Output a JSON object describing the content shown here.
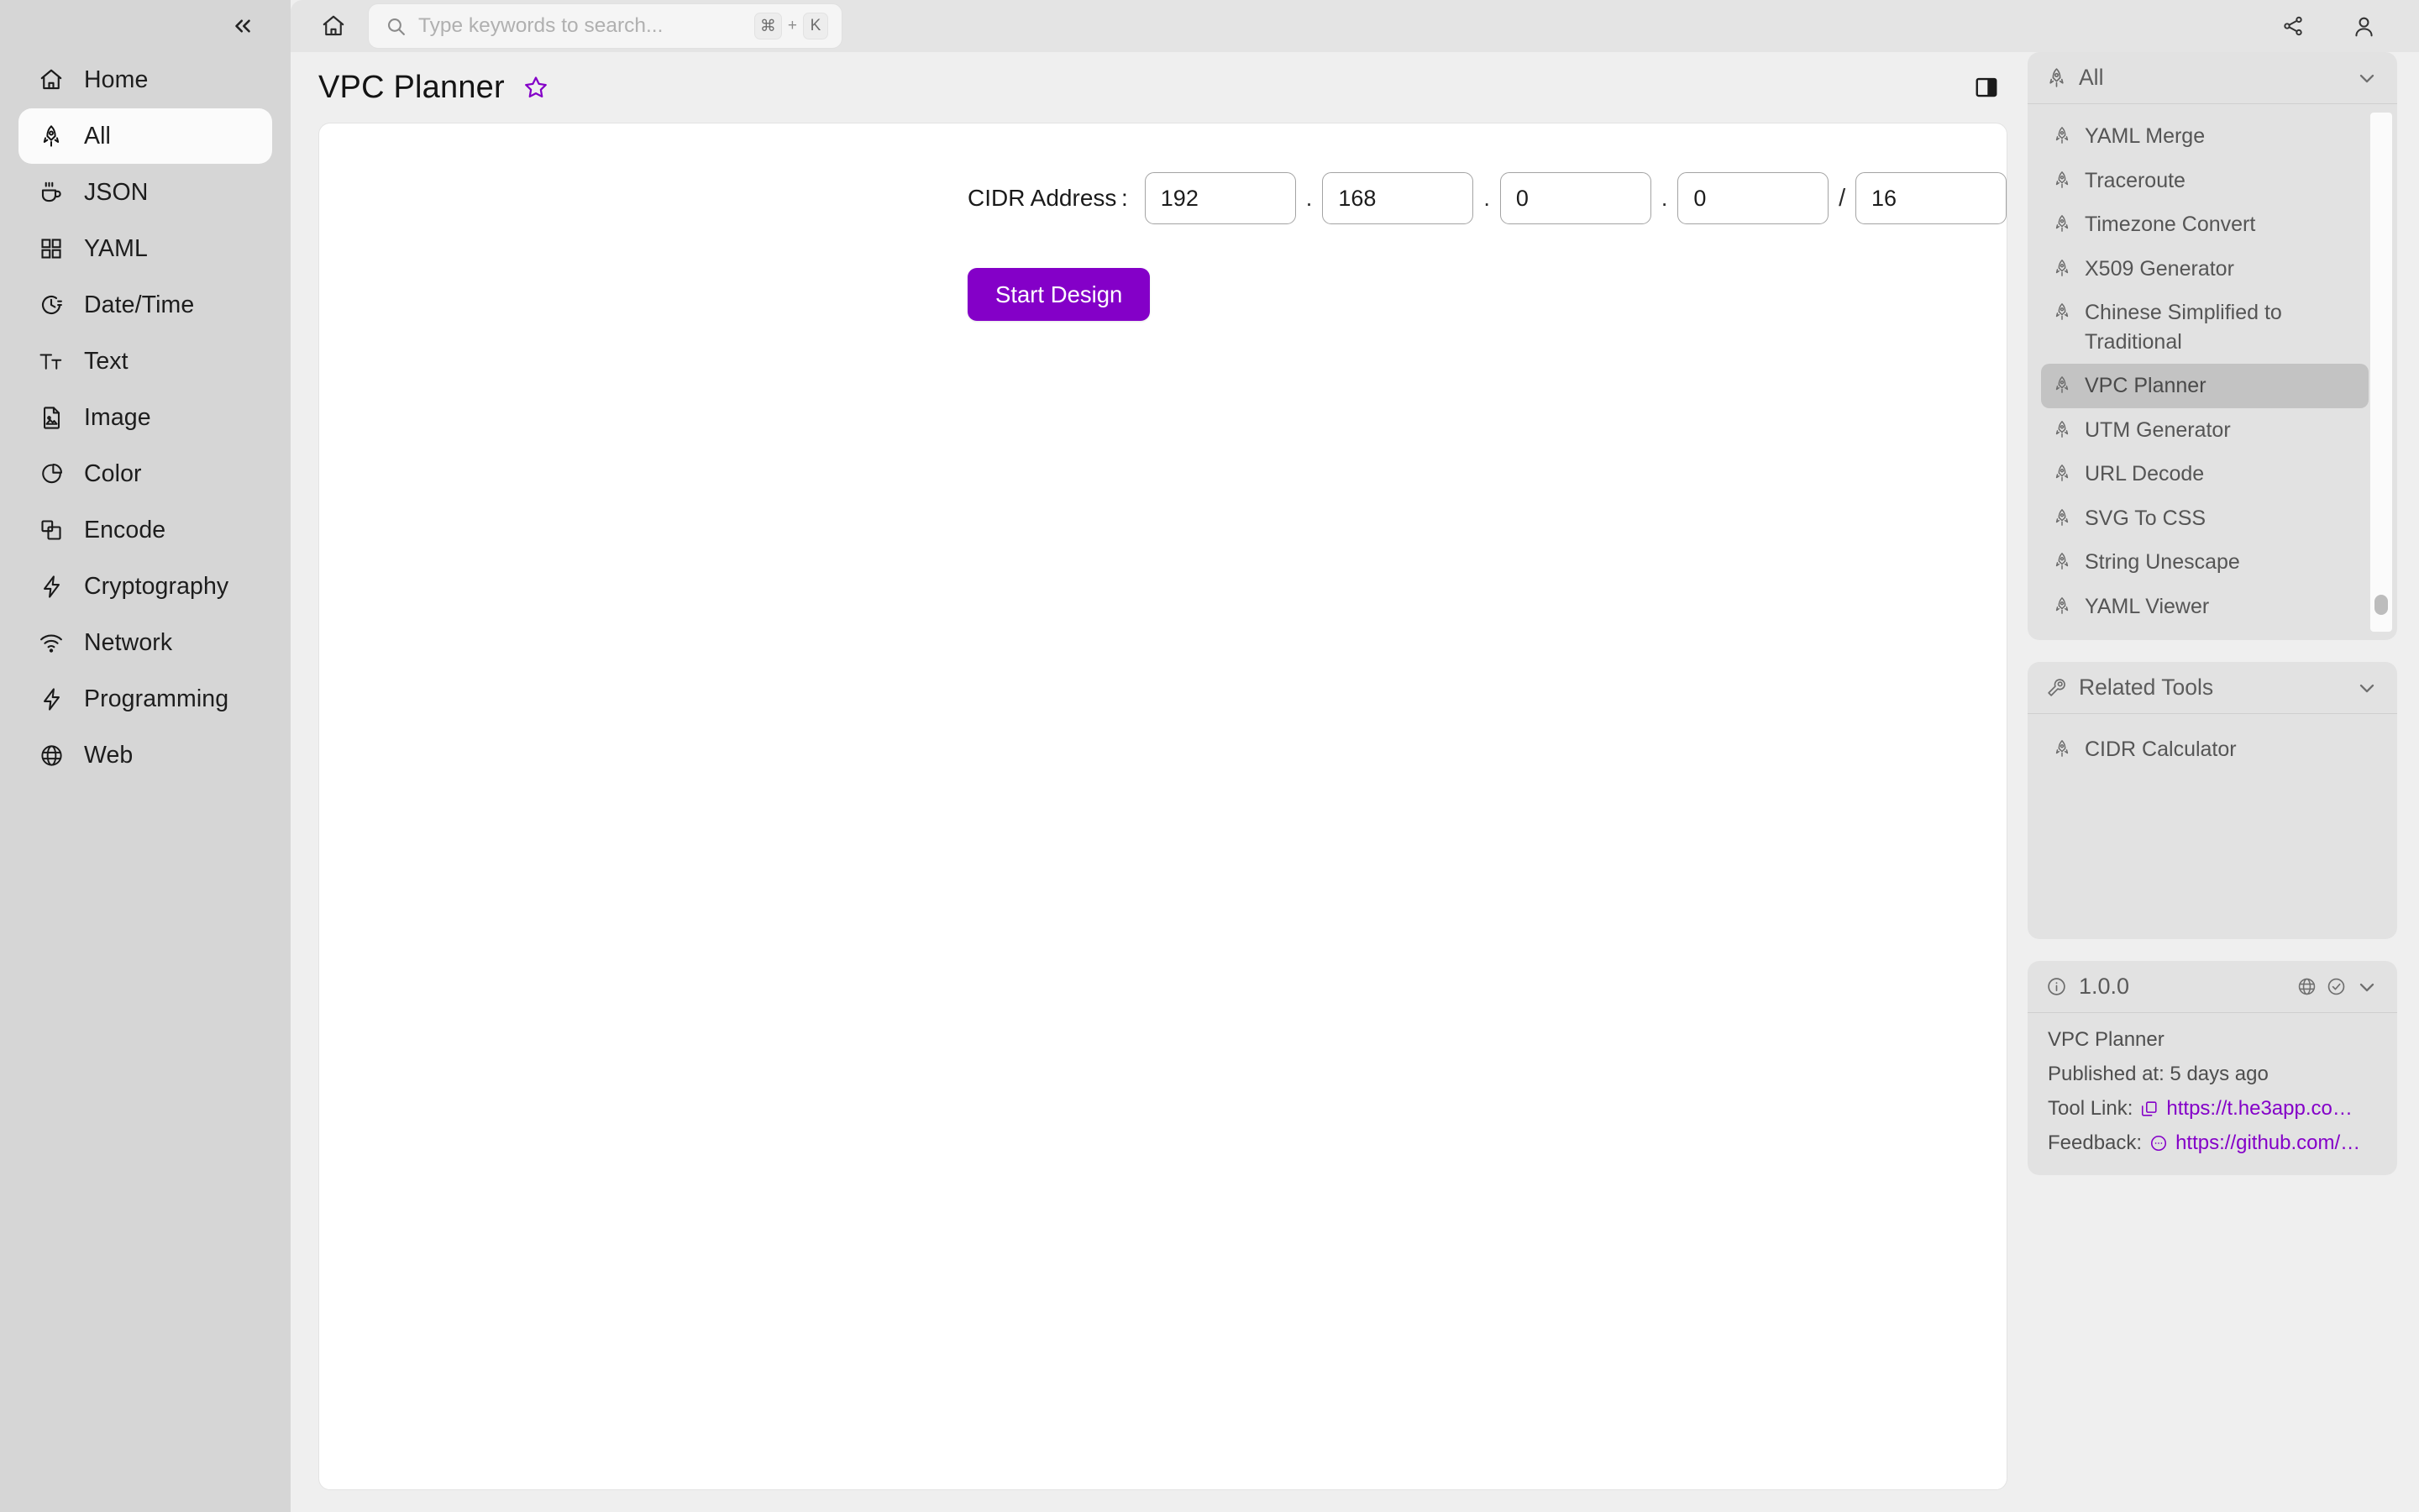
{
  "sidebar": {
    "collapse_icon": "chevrons-left-icon",
    "items": [
      {
        "label": "Home",
        "icon": "home-icon",
        "active": false
      },
      {
        "label": "All",
        "icon": "rocket-icon",
        "active": true
      },
      {
        "label": "JSON",
        "icon": "coffee-icon",
        "active": false
      },
      {
        "label": "YAML",
        "icon": "grid-icon",
        "active": false
      },
      {
        "label": "Date/Time",
        "icon": "clock-icon",
        "active": false
      },
      {
        "label": "Text",
        "icon": "text-size-icon",
        "active": false
      },
      {
        "label": "Image",
        "icon": "image-file-icon",
        "active": false
      },
      {
        "label": "Color",
        "icon": "pie-chart-icon",
        "active": false
      },
      {
        "label": "Encode",
        "icon": "layers-icon",
        "active": false
      },
      {
        "label": "Cryptography",
        "icon": "bolt-icon",
        "active": false
      },
      {
        "label": "Network",
        "icon": "wifi-icon",
        "active": false
      },
      {
        "label": "Programming",
        "icon": "bolt-icon",
        "active": false
      },
      {
        "label": "Web",
        "icon": "globe-icon",
        "active": false
      }
    ]
  },
  "topbar": {
    "home_icon": "home-icon",
    "search": {
      "placeholder": "Type keywords to search...",
      "value": "",
      "icon": "search-icon",
      "shortcut_key1": "⌘",
      "shortcut_plus": "+",
      "shortcut_key2": "K"
    },
    "share_icon": "share-icon",
    "account_icon": "user-icon"
  },
  "page": {
    "title": "VPC Planner",
    "favorite_icon": "star-outline-icon",
    "favorite_color": "#8400c8",
    "panel_toggle_icon": "panel-right-icon"
  },
  "form": {
    "cidr_label": "CIDR Address :",
    "octets": [
      "192",
      "168",
      "0",
      "0"
    ],
    "prefix": "16",
    "dot": ".",
    "slash": "/",
    "submit_label": "Start Design",
    "submit_color": "#8400c8"
  },
  "rail": {
    "tools_panel": {
      "title": "All",
      "icon": "rocket-icon",
      "chevron": "chevron-down-icon",
      "items": [
        {
          "label": "YAML Merge",
          "selected": false
        },
        {
          "label": "Traceroute",
          "selected": false
        },
        {
          "label": "Timezone Convert",
          "selected": false
        },
        {
          "label": "X509 Generator",
          "selected": false
        },
        {
          "label": "Chinese Simplified to Traditional",
          "selected": false
        },
        {
          "label": "VPC Planner",
          "selected": true
        },
        {
          "label": "UTM Generator",
          "selected": false
        },
        {
          "label": "URL Decode",
          "selected": false
        },
        {
          "label": "SVG To CSS",
          "selected": false
        },
        {
          "label": "String Unescape",
          "selected": false
        },
        {
          "label": "YAML Viewer",
          "selected": false
        }
      ]
    },
    "related_panel": {
      "title": "Related Tools",
      "icon": "wrench-icon",
      "chevron": "chevron-down-icon",
      "items": [
        {
          "label": "CIDR Calculator"
        }
      ]
    },
    "info_panel": {
      "version": "1.0.0",
      "info_icon": "info-circle-icon",
      "globe_icon": "globe-icon",
      "check_icon": "check-circle-icon",
      "chevron": "chevron-down-icon",
      "tool_name": "VPC Planner",
      "published_text": "Published at: 5 days ago",
      "tool_link_label": "Tool Link:",
      "tool_link_value": "https://t.he3app.co…",
      "tool_link_icon": "copy-icon",
      "feedback_label": "Feedback:",
      "feedback_value": "https://github.com/…",
      "feedback_icon": "comment-icon"
    }
  }
}
